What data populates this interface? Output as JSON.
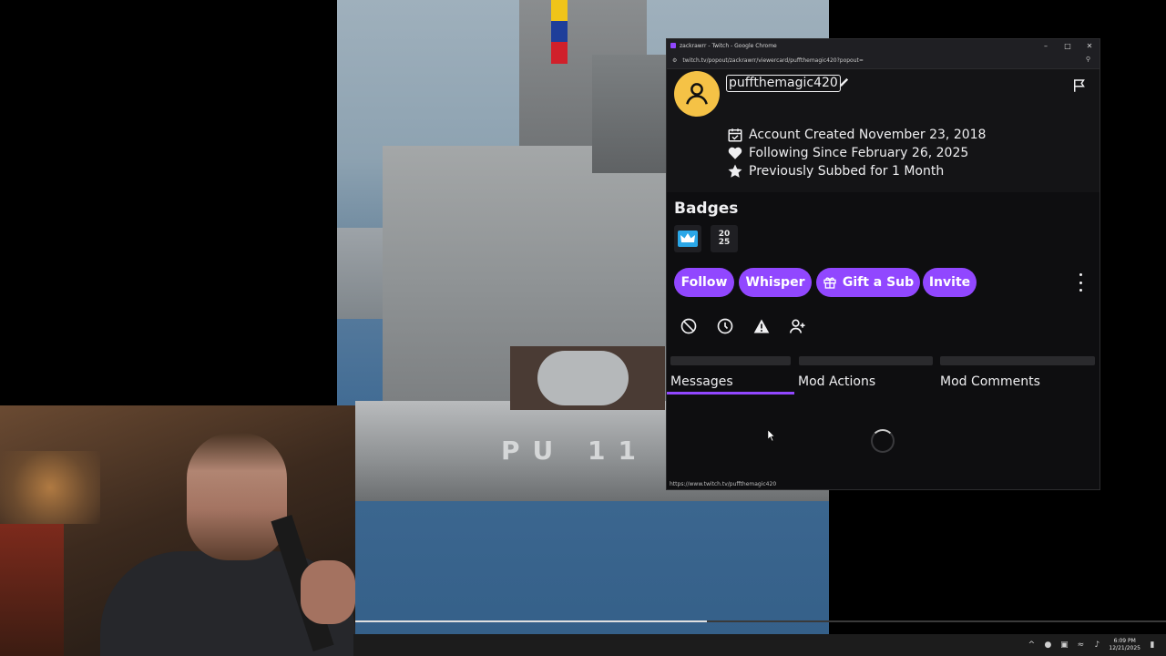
{
  "window": {
    "title": "zackrawrr - Twitch - Google Chrome",
    "url": "twitch.tv/popout/zackrawrr/viewercard/puffthemagic420?popout=",
    "controls": [
      "minimize",
      "maximize",
      "close"
    ]
  },
  "viewer_card": {
    "username": "puffthemagic420",
    "info": {
      "account_created": "Account Created November 23, 2018",
      "following_since": "Following Since February 26, 2025",
      "previously_subbed": "Previously Subbed for 1 Month"
    },
    "badges_title": "Badges",
    "badges": [
      {
        "name": "subscriber-crown-badge",
        "color": "#2aa7e8"
      },
      {
        "name": "2025-badge",
        "text": "20\n25"
      }
    ],
    "actions": {
      "follow": "Follow",
      "whisper": "Whisper",
      "gift_sub": "Gift a Sub",
      "invite": "Invite"
    },
    "mod_tools": [
      "ban-icon",
      "timeout-icon",
      "warn-icon",
      "add-mod-icon"
    ],
    "tabs": [
      {
        "label": "Messages",
        "active": true
      },
      {
        "label": "Mod Actions",
        "active": false
      },
      {
        "label": "Mod Comments",
        "active": false
      }
    ],
    "status_url": "https://www.twitch.tv/puffthemagic420"
  },
  "video": {
    "hull_text": "PU 11",
    "progress": 0.435
  },
  "taskbar": {
    "time": "6:09 PM",
    "date": "12/21/2025"
  },
  "colors": {
    "accent": "#9147ff",
    "avatar_bg": "#f5c246",
    "card_bg": "#0e0e10"
  }
}
